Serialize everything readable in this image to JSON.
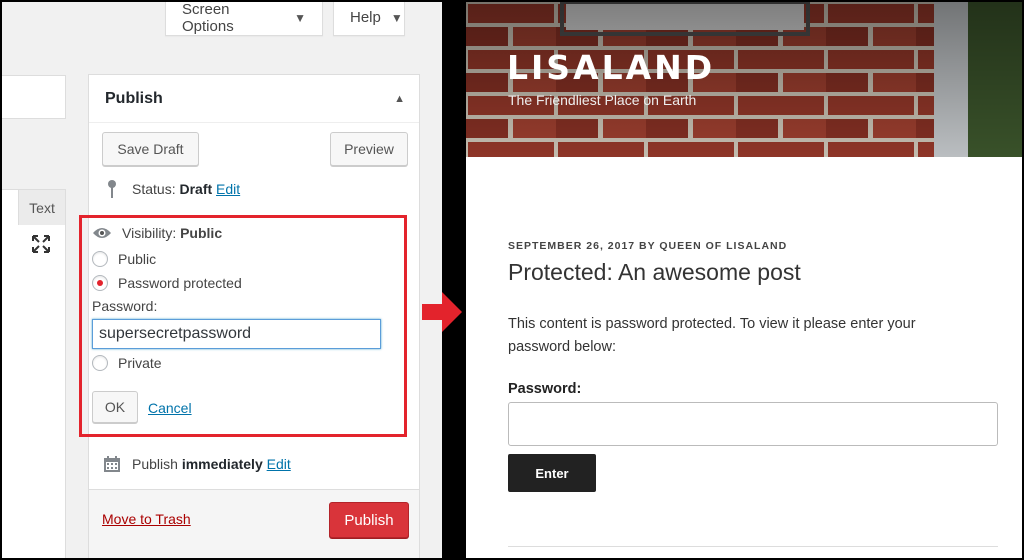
{
  "admin": {
    "screen_options": "Screen Options",
    "help": "Help",
    "text_tab": "Text",
    "publish": {
      "title": "Publish",
      "save_draft": "Save Draft",
      "preview": "Preview",
      "status_label": "Status:",
      "status_value": "Draft",
      "edit": "Edit",
      "visibility_label": "Visibility:",
      "visibility_value": "Public",
      "options": [
        "Public",
        "Password protected",
        "Private"
      ],
      "selected_option": "Password protected",
      "password_label": "Password:",
      "password_value": "supersecretpassword",
      "ok": "OK",
      "cancel": "Cancel",
      "publish_label": "Publish",
      "publish_when": "immediately",
      "move_to_trash": "Move to Trash",
      "publish_button": "Publish"
    }
  },
  "site": {
    "title": "LISALAND",
    "tagline": "The Friendliest Place on Earth",
    "post_meta": "SEPTEMBER 26, 2017 BY QUEEN OF LISALAND",
    "post_title": "Protected: An awesome post",
    "notice": "This content is password protected. To view it please enter your password below:",
    "password_label": "Password:",
    "enter_button": "Enter"
  },
  "colors": {
    "highlight_border": "#e3232c",
    "publish_button": "#d9343a",
    "link": "#0073aa",
    "trash_link": "#a00000"
  }
}
